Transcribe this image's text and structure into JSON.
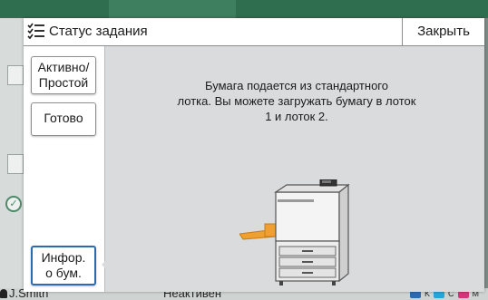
{
  "background": {
    "user_name": "J.Smith",
    "status_text": "Неактивен",
    "toner_labels": [
      "K",
      "C",
      "M"
    ]
  },
  "dialog": {
    "title": "Статус задания",
    "close_label": "Закрыть",
    "sidebar": {
      "items": [
        {
          "label_lines": [
            "Активно/",
            "Простой"
          ]
        },
        {
          "label_lines": [
            "Готово"
          ]
        },
        {
          "label_lines": [
            "Инфор.",
            "о бум."
          ]
        }
      ]
    },
    "message_lines": [
      "Бумага подается из стандартного",
      "лотка. Вы можете загружать бумагу в лоток",
      "1 и лоток 2."
    ]
  },
  "colors": {
    "accent": "#2b6cb0",
    "tray_orange": "#f0a030",
    "header_bg": "#ffffff",
    "content_bg": "#d9dbdc"
  },
  "icons": [
    "job-status-list-icon",
    "printer-icon",
    "check-circle-icon",
    "user-icon",
    "toner-icon"
  ]
}
